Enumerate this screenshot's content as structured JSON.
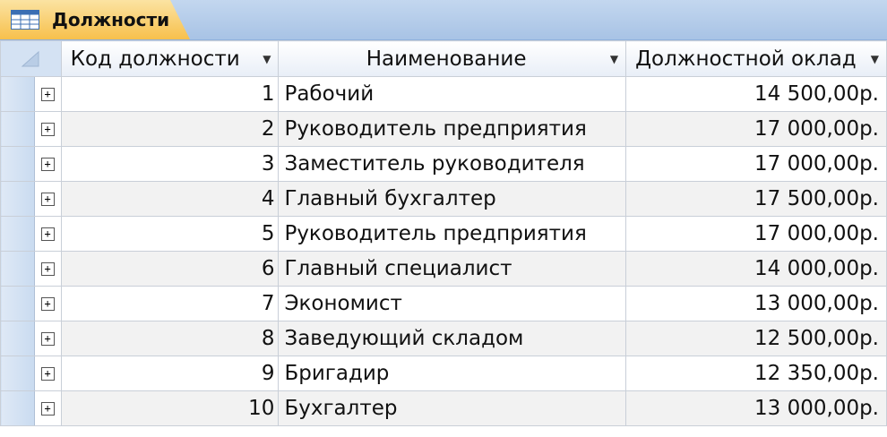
{
  "tab": {
    "label": "Должности",
    "icon": "table-icon"
  },
  "columns": [
    {
      "label": "Код должности"
    },
    {
      "label": "Наименование"
    },
    {
      "label": "Должностной оклад"
    }
  ],
  "rows": [
    {
      "code": "1",
      "name": "Рабочий",
      "salary": "14 500,00р."
    },
    {
      "code": "2",
      "name": "Руководитель предприятия",
      "salary": "17 000,00р."
    },
    {
      "code": "3",
      "name": "Заместитель руководителя",
      "salary": "17 000,00р."
    },
    {
      "code": "4",
      "name": "Главный бухгалтер",
      "salary": "17 500,00р."
    },
    {
      "code": "5",
      "name": "Руководитель предприятия",
      "salary": "17 000,00р."
    },
    {
      "code": "6",
      "name": "Главный специалист",
      "salary": "14 000,00р."
    },
    {
      "code": "7",
      "name": "Экономист",
      "salary": "13 000,00р."
    },
    {
      "code": "8",
      "name": "Заведующий складом",
      "salary": "12 500,00р."
    },
    {
      "code": "9",
      "name": "Бригадир",
      "salary": "12 350,00р."
    },
    {
      "code": "10",
      "name": "Бухгалтер",
      "salary": "13 000,00р."
    }
  ]
}
